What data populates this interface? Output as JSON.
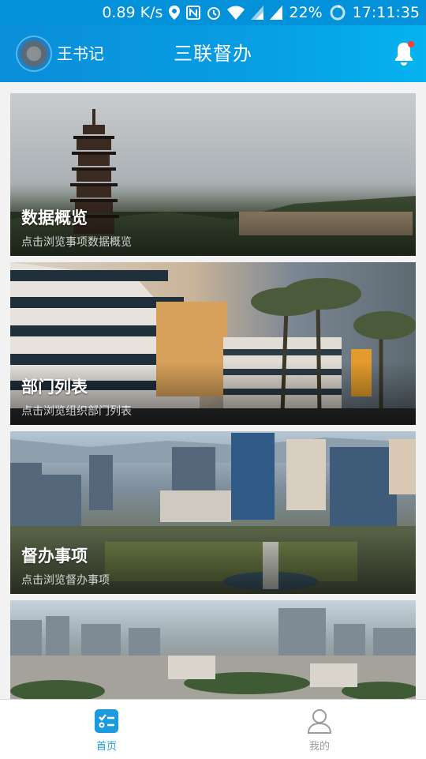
{
  "status_bar": {
    "net_speed": "0.89 K/s",
    "battery": "22%",
    "time": "17:11:35",
    "icons": [
      "location-icon",
      "nfc-icon",
      "alarm-icon",
      "wifi-icon",
      "signal-icon",
      "signal-icon",
      "battery-icon"
    ]
  },
  "header": {
    "user_name": "王书记",
    "title": "三联督办",
    "accent_color": "#0b8ed9",
    "bell_badge_color": "#ff3b30"
  },
  "cards": [
    {
      "title": "数据概览",
      "subtitle": "点击浏览事项数据概览"
    },
    {
      "title": "部门列表",
      "subtitle": "点击浏览组织部门列表"
    },
    {
      "title": "督办事项",
      "subtitle": "点击浏览督办事项"
    },
    {
      "title": "",
      "subtitle": ""
    }
  ],
  "tab_bar": {
    "home_label": "首页",
    "mine_label": "我的",
    "active_color": "#1a9be0",
    "inactive_color": "#9a9a9a"
  }
}
